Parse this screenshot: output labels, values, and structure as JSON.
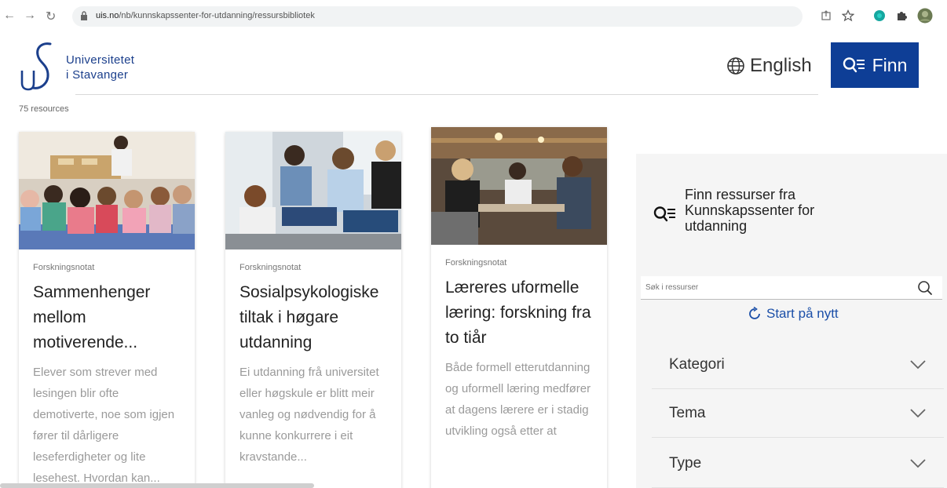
{
  "browser": {
    "url_host": "uis.no",
    "url_path": "/nb/kunnskapssenter-for-utdanning/ressursbibliotek"
  },
  "header": {
    "brand_line1": "Universitetet",
    "brand_line2": "i Stavanger",
    "language_label": "English",
    "finn_label": "Finn"
  },
  "results": {
    "count_label": "75 resources"
  },
  "cards": [
    {
      "type": "Forskningsnotat",
      "title": "Sammenhenger mellom motiverende...",
      "description": "Elever som strever med lesingen blir ofte demotiverte, noe som igjen fører til dårligere leseferdigheter og lite lesehest. Hvordan kan..."
    },
    {
      "type": "Forskningsnotat",
      "title": "Sosialpsykologiske tiltak i høgare utdanning",
      "description": "Ei utdanning frå universitet eller høgskule er blitt meir vanleg og nødvendig for å kunne konkurrere i eit kravstande..."
    },
    {
      "type": "Forskningsnotat",
      "title": "Læreres uformelle læring: forskning fra to tiår",
      "description": "Både formell etterutdanning og uformell læring medfører at dagens lærere er i stadig utvikling også etter at"
    }
  ],
  "sidebar": {
    "title": "Finn ressurser fra Kunnskapssenter for utdanning",
    "search_placeholder": "Søk i ressurser",
    "restart_label": "Start på nytt",
    "facets": [
      "Kategori",
      "Tema",
      "Type"
    ]
  },
  "colors": {
    "brand_blue": "#0e3e96",
    "link_blue": "#1b4fa8"
  }
}
